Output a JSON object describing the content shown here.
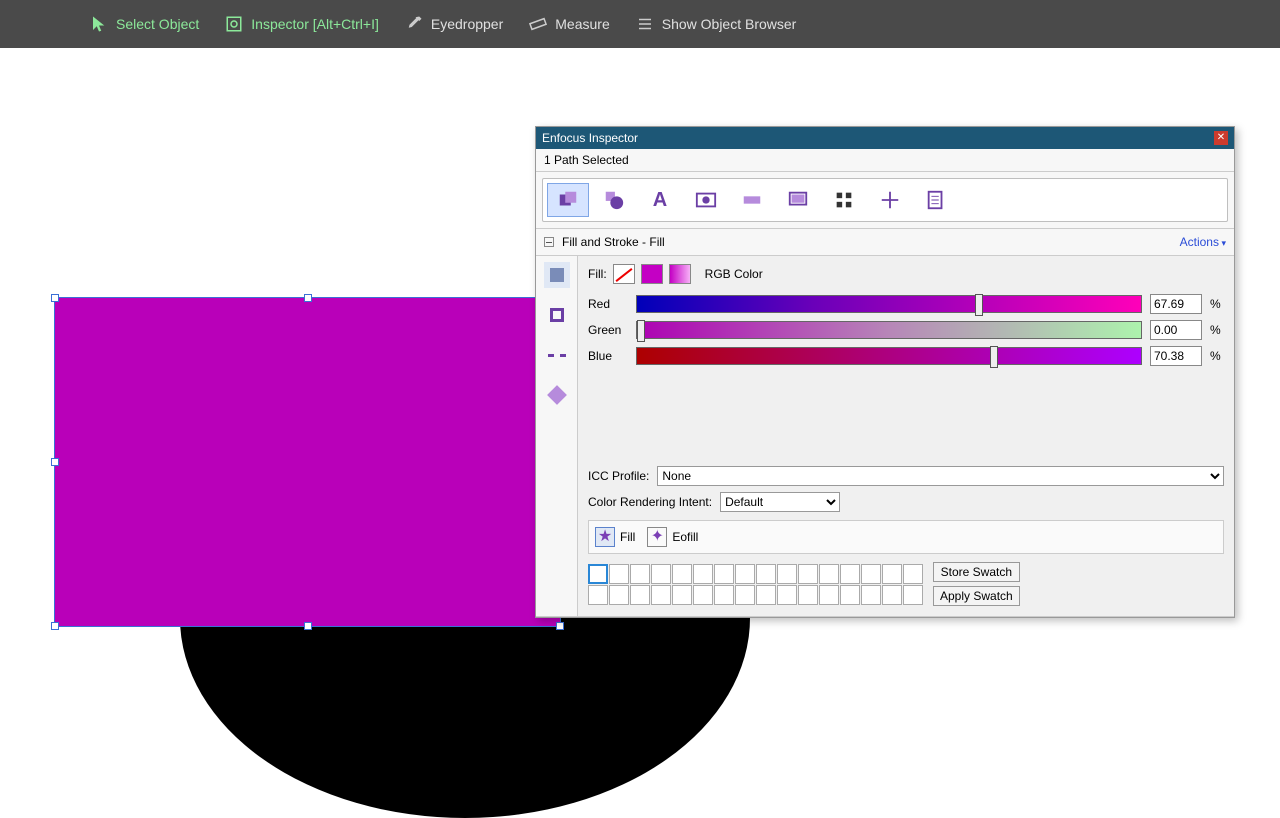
{
  "toolbar": {
    "select": "Select Object",
    "inspector": "Inspector [Alt+Ctrl+I]",
    "eyedropper": "Eyedropper",
    "measure": "Measure",
    "browser": "Show Object Browser"
  },
  "inspector": {
    "title": "Enfocus Inspector",
    "status": "1 Path Selected",
    "section": "Fill and Stroke - Fill",
    "actions": "Actions",
    "fill_label": "Fill:",
    "color_space": "RGB Color",
    "channels": {
      "red": {
        "label": "Red",
        "value": "67.69",
        "pos": 67.69
      },
      "green": {
        "label": "Green",
        "value": "0.00",
        "pos": 0.0
      },
      "blue": {
        "label": "Blue",
        "value": "70.38",
        "pos": 70.38
      }
    },
    "icc_label": "ICC Profile:",
    "icc_value": "None",
    "render_label": "Color Rendering Intent:",
    "render_value": "Default",
    "fill_type": {
      "fill": "Fill",
      "eofill": "Eofill"
    },
    "store": "Store Swatch",
    "apply": "Apply Swatch"
  }
}
